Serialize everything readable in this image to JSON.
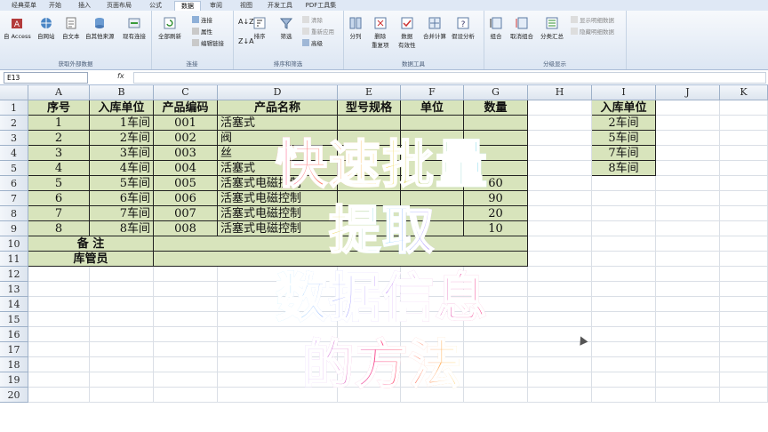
{
  "ribbon_tabs": [
    "经典菜单",
    "开始",
    "插入",
    "页面布局",
    "公式",
    "数据",
    "审阅",
    "视图",
    "开发工具",
    "PDF工具集"
  ],
  "active_tab_index": 5,
  "ribbon_groups": {
    "external": {
      "label": "获取外部数据",
      "buttons": [
        "自 Access",
        "自网站",
        "自文本",
        "自其他来源",
        "现有连接"
      ]
    },
    "connections": {
      "label": "连接",
      "big": "全部刷新",
      "small": [
        "连接",
        "属性",
        "编辑链接"
      ]
    },
    "sort": {
      "label": "排序和筛选",
      "buttons": [
        "排序",
        "筛选"
      ],
      "small": [
        "清除",
        "重新应用",
        "高级"
      ]
    },
    "datatools": {
      "label": "数据工具",
      "buttons": [
        "分列",
        "删除\n重复项",
        "数据\n有效性",
        "合并计算",
        "假设分析"
      ]
    },
    "outline": {
      "label": "分级显示",
      "buttons": [
        "组合",
        "取消组合",
        "分类汇总"
      ],
      "small": [
        "显示明细数据",
        "隐藏明细数据"
      ]
    }
  },
  "name_box": "E13",
  "fx_label": "fx",
  "columns": [
    "A",
    "B",
    "C",
    "D",
    "E",
    "F",
    "G",
    "H",
    "I",
    "J",
    "K"
  ],
  "rows": [
    "1",
    "2",
    "3",
    "4",
    "5",
    "6",
    "7",
    "8",
    "9",
    "10",
    "11",
    "12",
    "13",
    "14",
    "15",
    "16",
    "17",
    "18",
    "19",
    "20"
  ],
  "table": {
    "headers": [
      "序号",
      "入库单位",
      "产品编码",
      "产品名称",
      "型号规格",
      "单位",
      "数量"
    ],
    "rows": [
      {
        "no": "1",
        "unit": "1车间",
        "code": "001",
        "name": "活塞式",
        "qty": ""
      },
      {
        "no": "2",
        "unit": "2车间",
        "code": "002",
        "name": "阀",
        "qty": ""
      },
      {
        "no": "3",
        "unit": "3车间",
        "code": "003",
        "name": "丝",
        "qty": ""
      },
      {
        "no": "4",
        "unit": "4车间",
        "code": "004",
        "name": "活塞式",
        "qty": ""
      },
      {
        "no": "5",
        "unit": "5车间",
        "code": "005",
        "name": "活塞式电磁控制",
        "qty": "60"
      },
      {
        "no": "6",
        "unit": "6车间",
        "code": "006",
        "name": "活塞式电磁控制",
        "qty": "90"
      },
      {
        "no": "7",
        "unit": "7车间",
        "code": "007",
        "name": "活塞式电磁控制",
        "qty": "20"
      },
      {
        "no": "8",
        "unit": "8车间",
        "code": "008",
        "name": "活塞式电磁控制",
        "qty": "10"
      }
    ],
    "remark_label": "备  注",
    "keeper_label": "库管员"
  },
  "side_table": {
    "header": "入库单位",
    "values": [
      "2车间",
      "5车间",
      "7车间",
      "8车间"
    ]
  },
  "overlay_title": [
    "快速批量",
    "提取",
    "数据信息",
    "的方法"
  ],
  "colors": {
    "green_cell": "#d8e4bc",
    "overlay_grad": [
      "#ff3d7f",
      "#ffd84a",
      "#6ad8ff",
      "#b57cff"
    ]
  }
}
